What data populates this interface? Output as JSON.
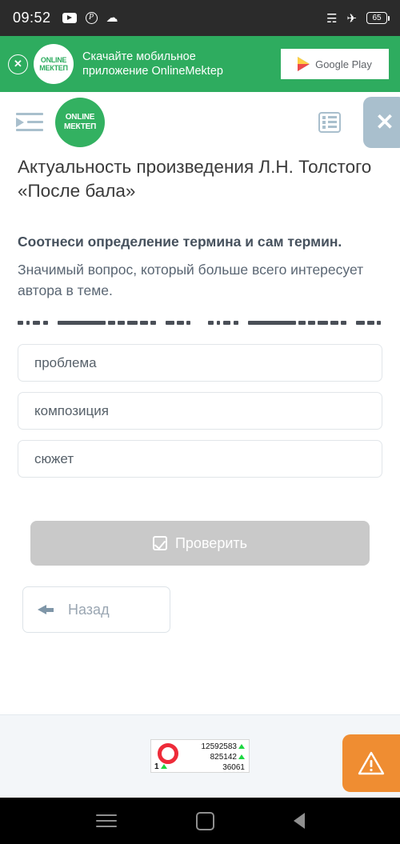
{
  "status_bar": {
    "time": "09:52",
    "icons": [
      "youtube-icon",
      "pinterest-icon",
      "cloud-icon"
    ],
    "wifi": "wifi-icon",
    "airplane": "airplane-mode-icon",
    "battery_level": "65"
  },
  "promo_banner": {
    "close_label": "✕",
    "logo_line1": "ONLINE",
    "logo_line2": "МЕКТЕП",
    "text_line1": "Скачайте мобильное",
    "text_line2": "приложение OnlineMektep",
    "store_button": "Google Play",
    "background_color": "#2eac5f"
  },
  "app_header": {
    "menu_icon": "indent-menu-icon",
    "logo_line1": "ONLINE",
    "logo_line2": "МЕКТЕП",
    "list_icon": "list-view-icon",
    "close_label": "✕",
    "accent_color": "#a9bfcd"
  },
  "lesson": {
    "title": "Актуальность произведения Л.Н. Толстого «После бала»",
    "prompt": "Соотнеси определение термина и сам термин.",
    "definition": "Значимый вопрос, который больше всего интересует автора в теме.",
    "redacted_note": "скрытый текст"
  },
  "options": [
    {
      "label": "проблема"
    },
    {
      "label": "композиция"
    },
    {
      "label": "сюжет"
    }
  ],
  "actions": {
    "check_label": "Проверить",
    "check_enabled": false,
    "check_color": "#c9c9c9",
    "back_label": "Назад"
  },
  "footer": {
    "counter": {
      "rank": "1",
      "views": "12592583",
      "visitors": "825142",
      "today": "36061"
    },
    "warning_button": "warning-icon",
    "warning_color": "#ef8d32"
  },
  "nav_bar": {
    "recents": "recents-button",
    "home": "home-button",
    "back": "back-button"
  }
}
